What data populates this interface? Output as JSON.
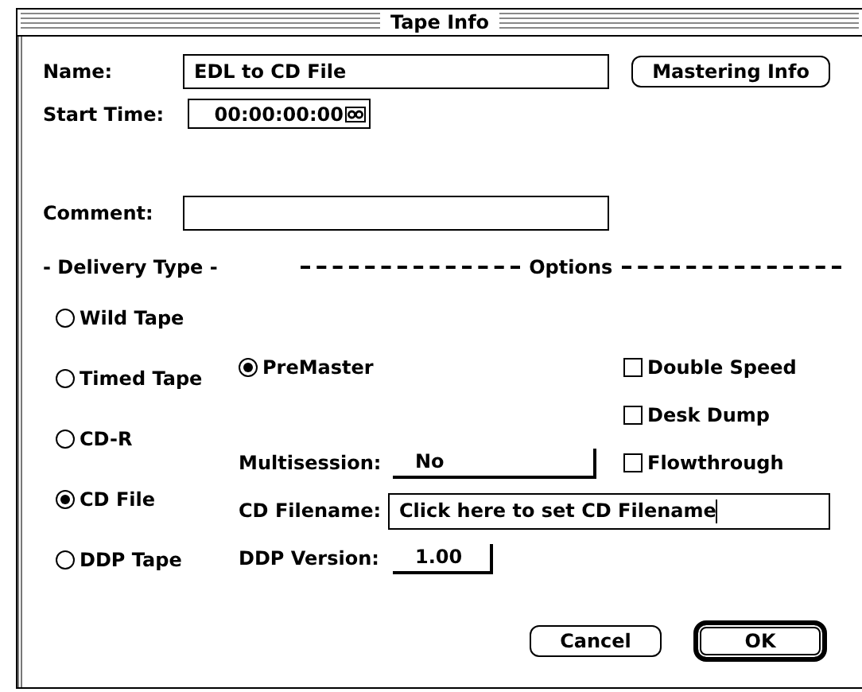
{
  "window": {
    "title": "Tape Info"
  },
  "name": {
    "label": "Name:",
    "value": "EDL to CD File"
  },
  "mastering_button": {
    "label": "Mastering Info"
  },
  "start_time": {
    "label": "Start Time:",
    "value": "00:00:00:00"
  },
  "comment": {
    "label": "Comment:"
  },
  "delivery_type": {
    "heading": "- Delivery Type -",
    "items": [
      {
        "label": "Wild Tape",
        "selected": false
      },
      {
        "label": "Timed Tape",
        "selected": false
      },
      {
        "label": "CD-R",
        "selected": false
      },
      {
        "label": "CD File",
        "selected": true
      },
      {
        "label": "DDP Tape",
        "selected": false
      }
    ]
  },
  "options": {
    "heading": "Options",
    "premaster": {
      "label": "PreMaster",
      "selected": true
    },
    "checkboxes": [
      {
        "label": "Double Speed",
        "checked": false
      },
      {
        "label": "Desk Dump",
        "checked": false
      },
      {
        "label": "Flowthrough",
        "checked": false
      }
    ],
    "multisession": {
      "label": "Multisession:",
      "value": "No"
    },
    "cd_filename": {
      "label": "CD Filename:",
      "value": "Click here to set CD Filename"
    },
    "ddp_version": {
      "label": "DDP Version:",
      "value": "1.00"
    }
  },
  "buttons": [
    {
      "label": "Cancel",
      "default": false
    },
    {
      "label": "OK",
      "default": true
    }
  ]
}
